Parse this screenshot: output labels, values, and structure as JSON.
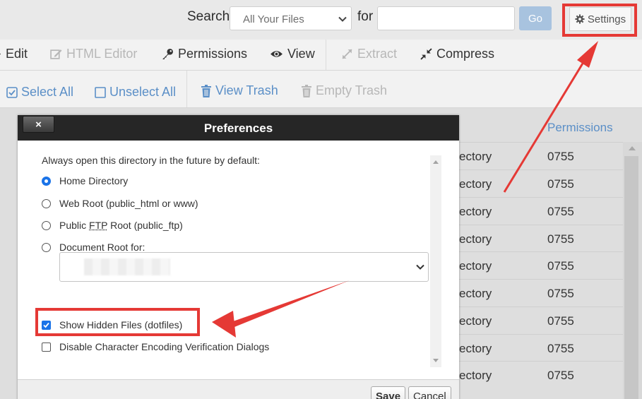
{
  "search_bar": {
    "search_label": "Search",
    "scope_value": "All Your Files",
    "for_label": "for",
    "query_value": "",
    "go_label": "Go",
    "settings_label": "Settings"
  },
  "toolbar": {
    "edit": "Edit",
    "html_editor": "HTML Editor",
    "permissions": "Permissions",
    "view": "View",
    "extract": "Extract",
    "compress": "Compress"
  },
  "selection_bar": {
    "select_all": "Select All",
    "unselect_all": "Unselect All",
    "view_trash": "View Trash",
    "empty_trash": "Empty Trash"
  },
  "file_table": {
    "permissions_header": "Permissions",
    "rows": [
      {
        "type": "ectory",
        "perm": "0755"
      },
      {
        "type": "ectory",
        "perm": "0755"
      },
      {
        "type": "ectory",
        "perm": "0755"
      },
      {
        "type": "ectory",
        "perm": "0755"
      },
      {
        "type": "ectory",
        "perm": "0755"
      },
      {
        "type": "ectory",
        "perm": "0755"
      },
      {
        "type": "ectory",
        "perm": "0755"
      },
      {
        "type": "ectory",
        "perm": "0755"
      },
      {
        "type": "ectory",
        "perm": "0755"
      }
    ]
  },
  "dialog": {
    "title": "Preferences",
    "close_label": "×",
    "default_dir_label": "Always open this directory in the future by default:",
    "options": {
      "home": "Home Directory",
      "web_root": "Web Root (public_html or www)",
      "ftp_before": "Public ",
      "ftp_abbr": "FTP",
      "ftp_after": " Root (public_ftp)",
      "doc_root": "Document Root for:"
    },
    "selected_option": "home",
    "show_hidden_label": "Show Hidden Files (dotfiles)",
    "show_hidden_checked": true,
    "disable_encoding_label": "Disable Character Encoding Verification Dialogs",
    "disable_encoding_checked": false,
    "save_label": "Save",
    "cancel_label": "Cancel"
  },
  "colors": {
    "accent": "#5b8fc7",
    "highlight": "#e53935",
    "dialog_titlebar": "#262626",
    "checkbox_blue": "#1a73e8"
  },
  "icons": {
    "settings": "gear-icon",
    "html_editor": "pencil-square-icon",
    "permissions": "key-icon",
    "view": "eye-icon",
    "extract": "expand-arrows-icon",
    "compress": "compress-arrows-icon",
    "select_all": "checked-box-icon",
    "unselect_all": "empty-box-icon",
    "trash": "trash-icon"
  }
}
